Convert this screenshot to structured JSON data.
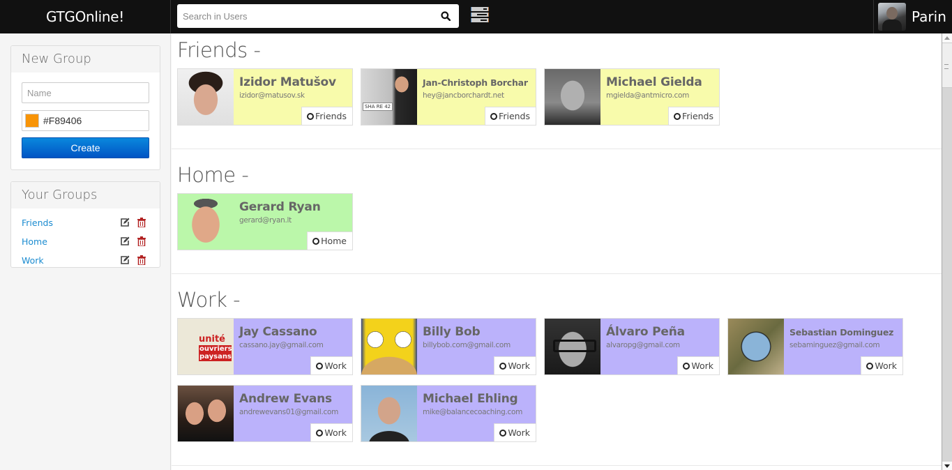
{
  "app": {
    "title": "GTGOnline!"
  },
  "header": {
    "search": {
      "placeholder": "Search in Users",
      "value": ""
    },
    "user": {
      "name": "Parin"
    }
  },
  "sidebar": {
    "new_group": {
      "title": "New Group",
      "name_placeholder": "Name",
      "color_value": "#F89406",
      "swatch_color": "#F89406",
      "create_label": "Create"
    },
    "your_groups": {
      "title": "Your Groups",
      "items": [
        {
          "label": "Friends"
        },
        {
          "label": "Home"
        },
        {
          "label": "Work"
        }
      ]
    }
  },
  "colors": {
    "friends": "#F8FBAB",
    "home": "#BBF7AA",
    "work": "#BBB2FB",
    "link": "#1A8BD0",
    "trash": "#B22222"
  },
  "sections": [
    {
      "title": "Friends -",
      "group": "Friends",
      "cards": [
        {
          "name": "Izidor Matušov",
          "email": "izidor@matusov.sk",
          "tag": "Friends"
        },
        {
          "name": "Jan-Christoph Borchar",
          "email": "hey@jancborchardt.net",
          "tag": "Friends"
        },
        {
          "name": "Michael Gielda",
          "email": "mgielda@antmicro.com",
          "tag": "Friends"
        }
      ]
    },
    {
      "title": "Home -",
      "group": "Home",
      "cards": [
        {
          "name": "Gerard Ryan",
          "email": "gerard@ryan.lt",
          "tag": "Home"
        }
      ]
    },
    {
      "title": "Work -",
      "group": "Work",
      "cards": [
        {
          "name": "Jay Cassano",
          "email": "cassano.jay@gmail.com",
          "tag": "Work"
        },
        {
          "name": "Billy Bob",
          "email": "billybob.com@gmail.com",
          "tag": "Work"
        },
        {
          "name": "Álvaro Peña",
          "email": "alvaropg@gmail.com",
          "tag": "Work"
        },
        {
          "name": "Sebastian Dominguez",
          "email": "sebaminguez@gmail.com",
          "tag": "Work"
        },
        {
          "name": "Andrew Evans",
          "email": "andrewevans01@gmail.com",
          "tag": "Work"
        },
        {
          "name": "Michael Ehling",
          "email": "mike@balancecoaching.com",
          "tag": "Work"
        }
      ]
    }
  ]
}
